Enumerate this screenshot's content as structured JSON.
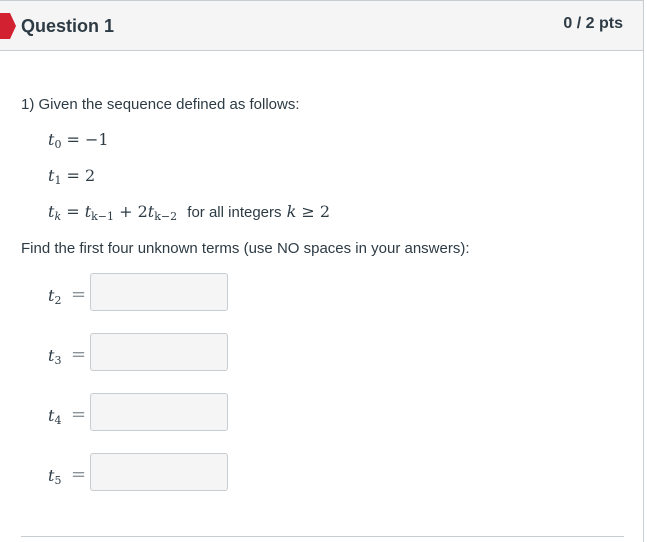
{
  "header": {
    "title": "Question 1",
    "points": "0 / 2 pts",
    "flag_color": "#d22232"
  },
  "question": {
    "prompt": "1) Given the sequence defined as follows:",
    "lines": [
      {
        "var": "t",
        "sub": "0",
        "rhs": "= −1"
      },
      {
        "var": "t",
        "sub": "1",
        "rhs": "= 2"
      }
    ],
    "recurrence": {
      "lhs_var": "t",
      "lhs_sub": "k",
      "eq": "=",
      "t1_var": "t",
      "t1_sub": "k−1",
      "plus": "+ 2",
      "t2_var": "t",
      "t2_sub": "k−2",
      "condition_text": "for all integers",
      "k": "k",
      "geq": "≥ 2"
    },
    "instructions": "Find the first four unknown terms (use NO spaces in your answers):"
  },
  "answers": [
    {
      "var": "t",
      "sub": "2",
      "eq": "=",
      "value": ""
    },
    {
      "var": "t",
      "sub": "3",
      "eq": "=",
      "value": ""
    },
    {
      "var": "t",
      "sub": "4",
      "eq": "=",
      "value": ""
    },
    {
      "var": "t",
      "sub": "5",
      "eq": "=",
      "value": ""
    }
  ]
}
